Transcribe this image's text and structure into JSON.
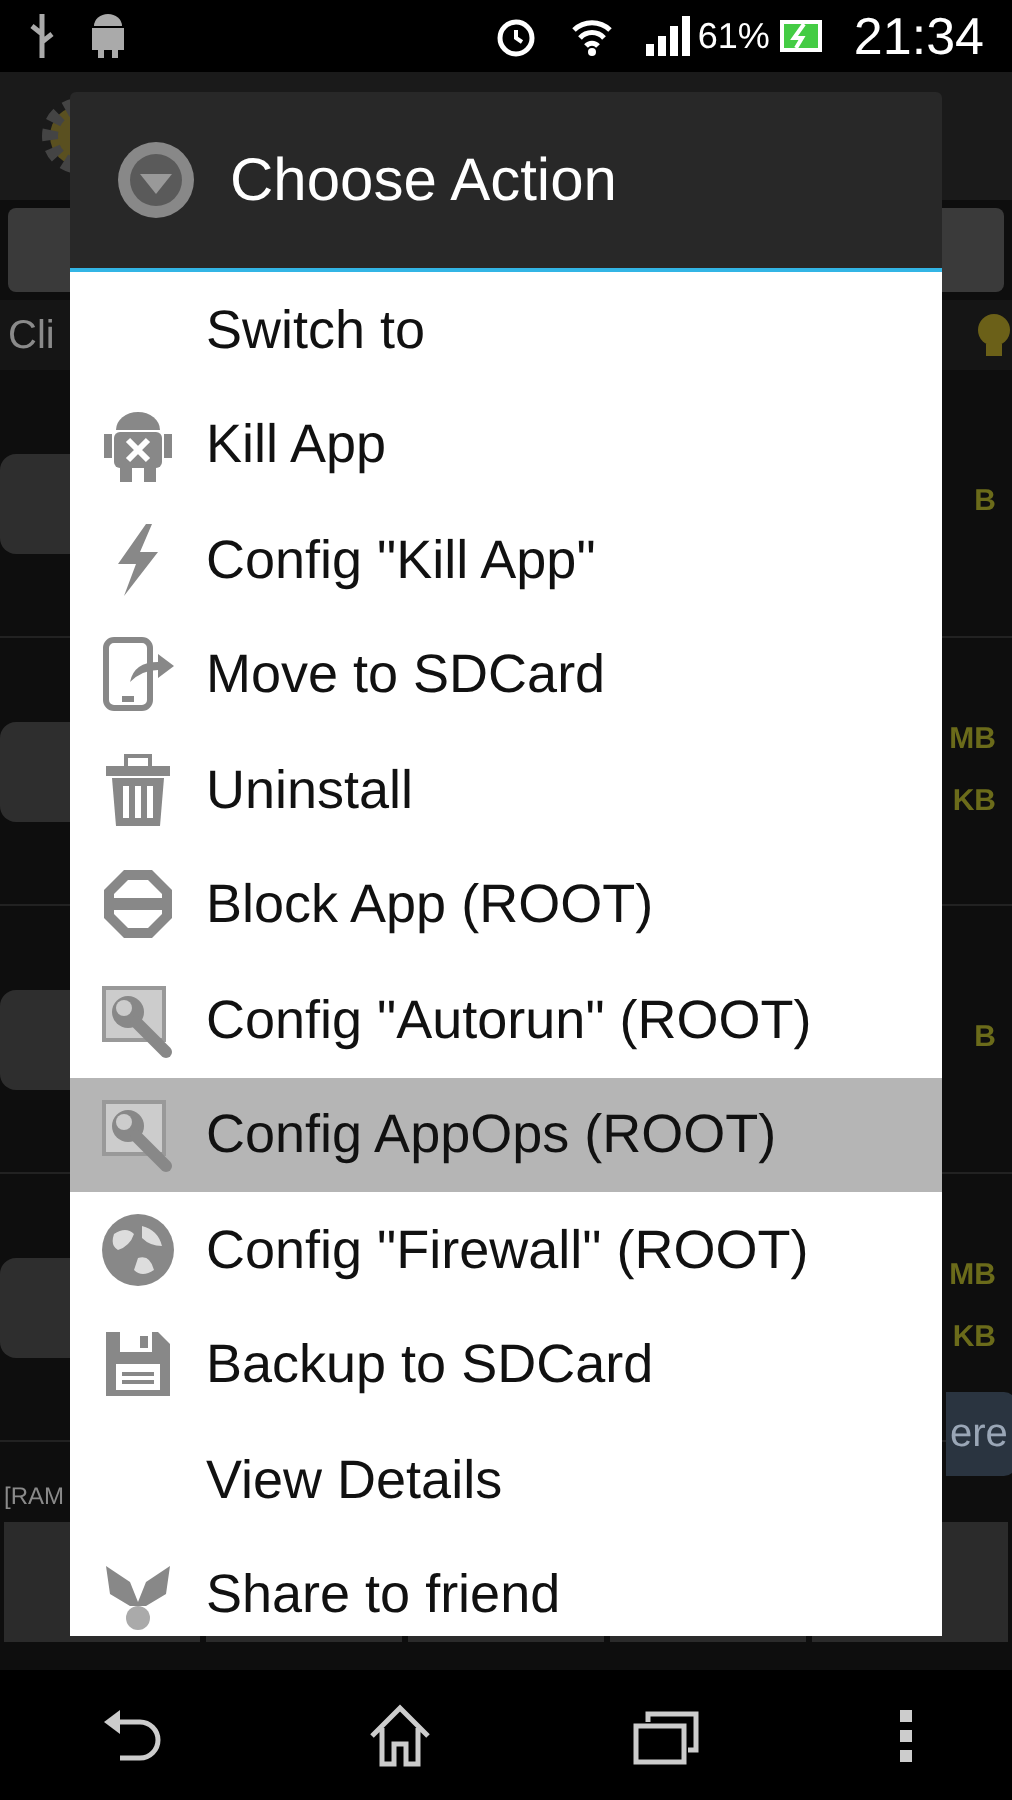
{
  "status_bar": {
    "battery": "61%",
    "time": "21:34"
  },
  "background": {
    "hint": "Cli",
    "ram": "[RAM",
    "button": "ere",
    "app_rows": [
      {
        "sizes": [
          "B"
        ]
      },
      {
        "sizes": [
          "MB",
          "KB"
        ]
      },
      {
        "sizes": [
          "B"
        ]
      },
      {
        "sizes": [
          "MB",
          "KB"
        ]
      }
    ]
  },
  "dialog": {
    "title": "Choose Action",
    "items": [
      {
        "label": "Switch to",
        "kind": "plain",
        "selected": false
      },
      {
        "label": "Kill App",
        "kind": "kill",
        "selected": false
      },
      {
        "label": "Config \"Kill App\"",
        "kind": "config",
        "selected": false
      },
      {
        "label": "Move to SDCard",
        "kind": "move",
        "selected": false
      },
      {
        "label": "Uninstall",
        "kind": "uninstall",
        "selected": false
      },
      {
        "label": "Block App (ROOT)",
        "kind": "block",
        "selected": false
      },
      {
        "label": "Config \"Autorun\" (ROOT)",
        "kind": "autorun",
        "selected": false
      },
      {
        "label": "Config AppOps (ROOT)",
        "kind": "autorun",
        "selected": true
      },
      {
        "label": "Config \"Firewall\" (ROOT)",
        "kind": "firewall",
        "selected": false
      },
      {
        "label": "Backup to SDCard",
        "kind": "backup",
        "selected": false
      },
      {
        "label": "View Details",
        "kind": "plain",
        "selected": false
      },
      {
        "label": "Share to friend",
        "kind": "share",
        "selected": false
      }
    ]
  }
}
